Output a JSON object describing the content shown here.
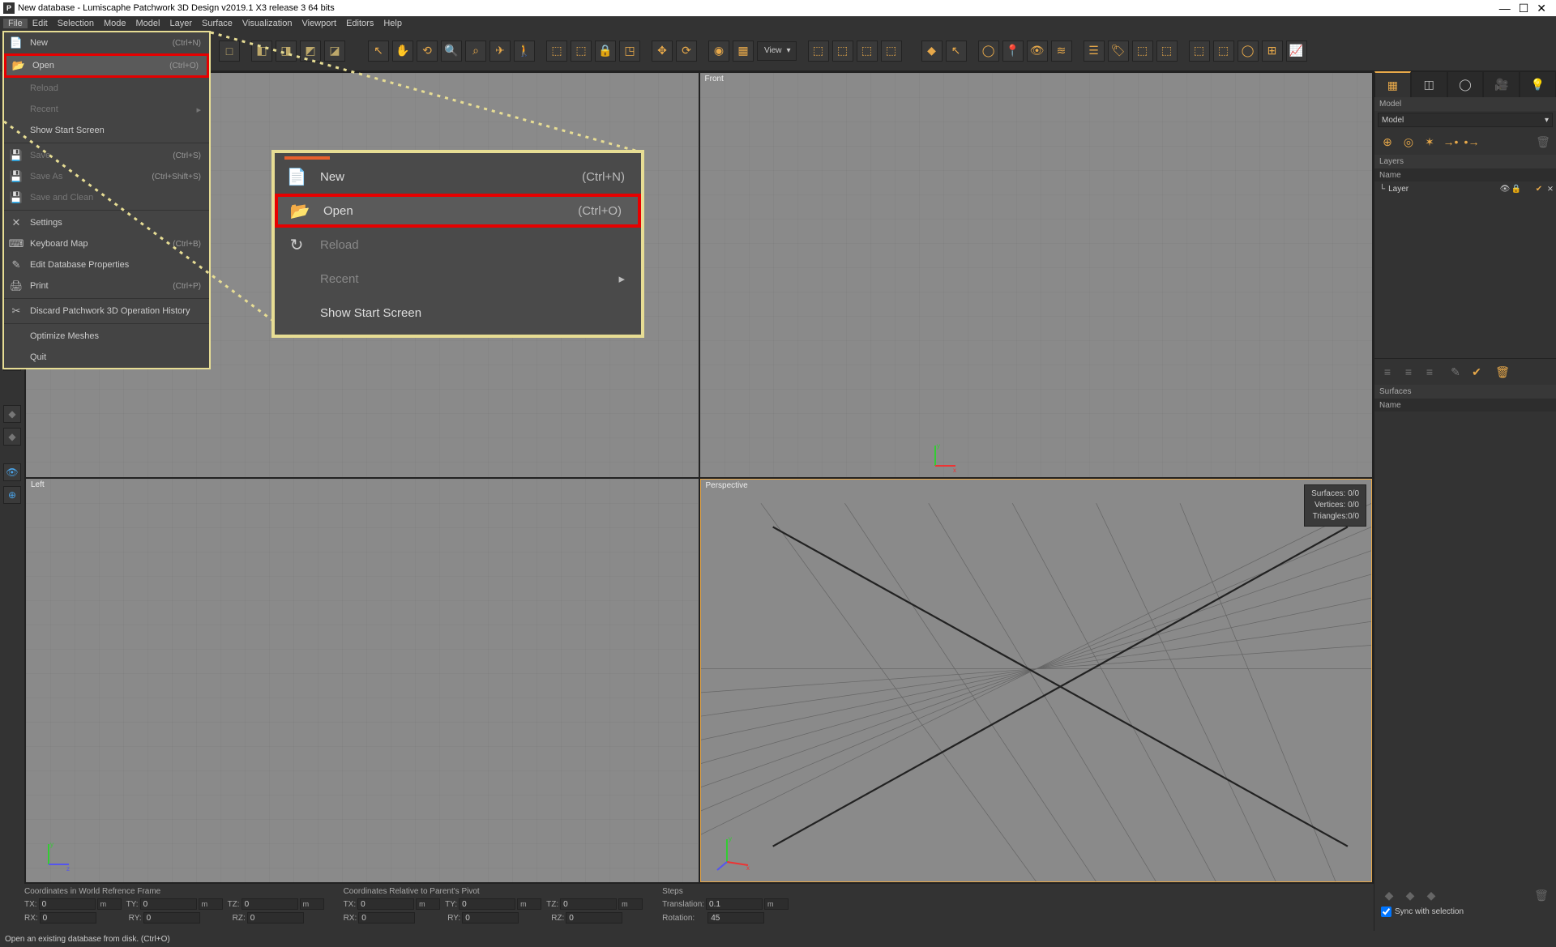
{
  "window": {
    "title": "New database - Lumiscaphe Patchwork 3D Design v2019.1 X3 release 3  64 bits",
    "app_icon_letter": "P"
  },
  "menubar": [
    "File",
    "Edit",
    "Selection",
    "Mode",
    "Model",
    "Layer",
    "Surface",
    "Visualization",
    "Viewport",
    "Editors",
    "Help"
  ],
  "toolbar_view_label": "View",
  "filemenu": [
    {
      "icon": "📄",
      "label": "New",
      "shortcut": "(Ctrl+N)"
    },
    {
      "icon": "📂",
      "label": "Open",
      "shortcut": "(Ctrl+O)",
      "highlight": true
    },
    {
      "icon": "",
      "label": "Reload",
      "disabled": true
    },
    {
      "icon": "",
      "label": "Recent",
      "disabled": true,
      "submenu": true
    },
    {
      "icon": "",
      "label": "Show Start Screen"
    },
    {
      "sep": true
    },
    {
      "icon": "💾",
      "label": "Save",
      "shortcut": "(Ctrl+S)",
      "disabled": true
    },
    {
      "icon": "💾",
      "label": "Save As",
      "shortcut": "(Ctrl+Shift+S)",
      "disabled": true
    },
    {
      "icon": "💾",
      "label": "Save and Clean",
      "disabled": true
    },
    {
      "sep": true
    },
    {
      "icon": "✕",
      "label": "Settings"
    },
    {
      "icon": "⌨",
      "label": "Keyboard Map",
      "shortcut": "(Ctrl+B)"
    },
    {
      "icon": "✎",
      "label": "Edit Database Properties"
    },
    {
      "icon": "🖨",
      "label": "Print",
      "shortcut": "(Ctrl+P)"
    },
    {
      "sep": true
    },
    {
      "icon": "✂",
      "label": "Discard Patchwork 3D Operation History"
    },
    {
      "sep": true
    },
    {
      "icon": "",
      "label": "Optimize Meshes"
    },
    {
      "icon": "",
      "label": "Quit"
    }
  ],
  "callout": [
    {
      "icon": "📄",
      "label": "New",
      "shortcut": "(Ctrl+N)"
    },
    {
      "icon": "📂",
      "label": "Open",
      "shortcut": "(Ctrl+O)",
      "highlight": true
    },
    {
      "icon": "↻",
      "label": "Reload",
      "disabled": true
    },
    {
      "icon": "",
      "label": "Recent",
      "disabled": true,
      "submenu": true
    },
    {
      "icon": "",
      "label": "Show Start Screen"
    }
  ],
  "viewports": {
    "tl": "",
    "tr": "Front",
    "bl": "Left",
    "br": "Perspective",
    "stats": {
      "surfaces": "Surfaces: 0/0",
      "vertices": "Vertices:  0/0",
      "triangles": "Triangles:0/0"
    }
  },
  "right_panel": {
    "model_label": "Model",
    "model_value": "Model",
    "layers_label": "Layers",
    "name_col": "Name",
    "layer_row": "Layer",
    "surfaces_label": "Surfaces",
    "name_col2": "Name",
    "sync_label": "Sync with selection"
  },
  "coords": {
    "world_label": "Coordinates in World Refrence Frame",
    "parent_label": "Coordinates Relative to Parent's Pivot",
    "steps_label": "Steps",
    "tx_label": "TX:",
    "ty_label": "TY:",
    "tz_label": "TZ:",
    "rx_label": "RX:",
    "ry_label": "RY:",
    "rz_label": "RZ:",
    "translation_label": "Translation:",
    "rotation_label": "Rotation:",
    "tx": "0",
    "ty": "0",
    "tz": "0",
    "rx": "0",
    "ry": "0",
    "rz": "0",
    "ptx": "0",
    "pty": "0",
    "ptz": "0",
    "prx": "0",
    "pry": "0",
    "prz": "0",
    "trans": "0.1",
    "rot": "45",
    "unit": "m"
  },
  "status": "Open an existing database from disk. (Ctrl+O)"
}
